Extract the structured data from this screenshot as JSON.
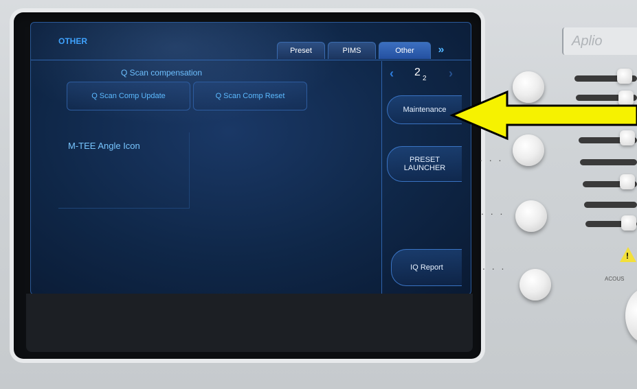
{
  "screen": {
    "title": "OTHER",
    "tabs": [
      {
        "label": "Preset",
        "active": false
      },
      {
        "label": "PIMS",
        "active": false
      },
      {
        "label": "Other",
        "active": true
      }
    ],
    "tab_expand_icon": "double-chevron-right-icon",
    "group_title": "Q  Scan compensation",
    "buttons": {
      "q_scan_update": "Q Scan Comp Update",
      "q_scan_reset": "Q Scan Comp Reset",
      "m_tee": "M-TEE Angle Icon"
    },
    "pager": {
      "current": "2",
      "total": "2",
      "prev_icon": "chevron-left-icon",
      "next_icon": "chevron-right-icon"
    },
    "side_buttons": {
      "maintenance": "Maintenance",
      "preset_launcher_1": "PRESET",
      "preset_launcher_2": "LAUNCHER",
      "iq_report": "IQ Report"
    }
  },
  "device": {
    "brand_text": "Aplio",
    "acoustic_label": "ACOUS"
  },
  "annotation": {
    "arrow_color": "#f6f200",
    "arrow_icon": "yellow-arrow-icon"
  }
}
